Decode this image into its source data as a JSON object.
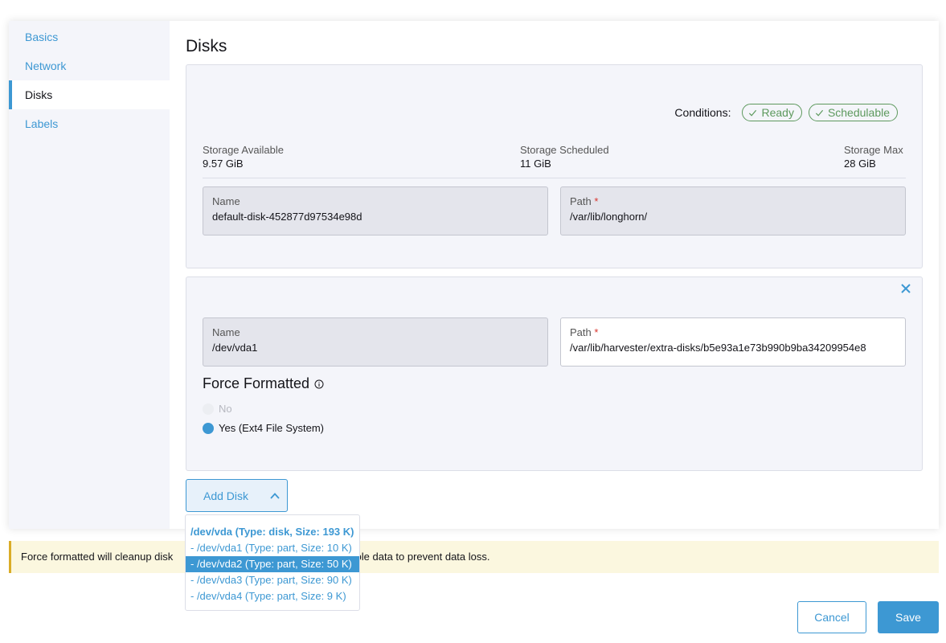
{
  "sidebar": {
    "items": [
      {
        "label": "Basics"
      },
      {
        "label": "Network"
      },
      {
        "label": "Disks"
      },
      {
        "label": "Labels"
      }
    ]
  },
  "page": {
    "title": "Disks"
  },
  "disk1": {
    "conditions_label": "Conditions:",
    "conditions": [
      "Ready",
      "Schedulable"
    ],
    "storage_available_label": "Storage Available",
    "storage_available": "9.57 GiB",
    "storage_scheduled_label": "Storage Scheduled",
    "storage_scheduled": "11 GiB",
    "storage_max_label": "Storage Max",
    "storage_max": "28 GiB",
    "name_label": "Name",
    "name": "default-disk-452877d97534e98d",
    "path_label": "Path",
    "path": "/var/lib/longhorn/"
  },
  "disk2": {
    "name_label": "Name",
    "name": "/dev/vda1",
    "path_label": "Path",
    "path": "/var/lib/harvester/extra-disks/b5e93a1e73b990b9ba34209954e8",
    "force_formatted_title": "Force Formatted",
    "option_no": "No",
    "option_yes": "Yes (Ext4 File System)",
    "selected": "yes"
  },
  "add_disk": {
    "label": "Add Disk",
    "options": [
      "/dev/vda (Type: disk, Size: 193 K)",
      "- /dev/vda1 (Type: part, Size: 10 K)",
      "- /dev/vda2 (Type: part, Size: 50 K)",
      "- /dev/vda3 (Type: part, Size: 90 K)",
      "- /dev/vda4 (Type: part, Size: 9 K)"
    ]
  },
  "banner": {
    "text_start": "Force formatted will cleanup disk",
    "text_end": "able data to prevent data loss."
  },
  "footer": {
    "cancel": "Cancel",
    "save": "Save"
  },
  "colors": {
    "accent": "#3d98d3",
    "success": "#5d995d",
    "warning": "#daac27",
    "required": "#d9352e"
  }
}
